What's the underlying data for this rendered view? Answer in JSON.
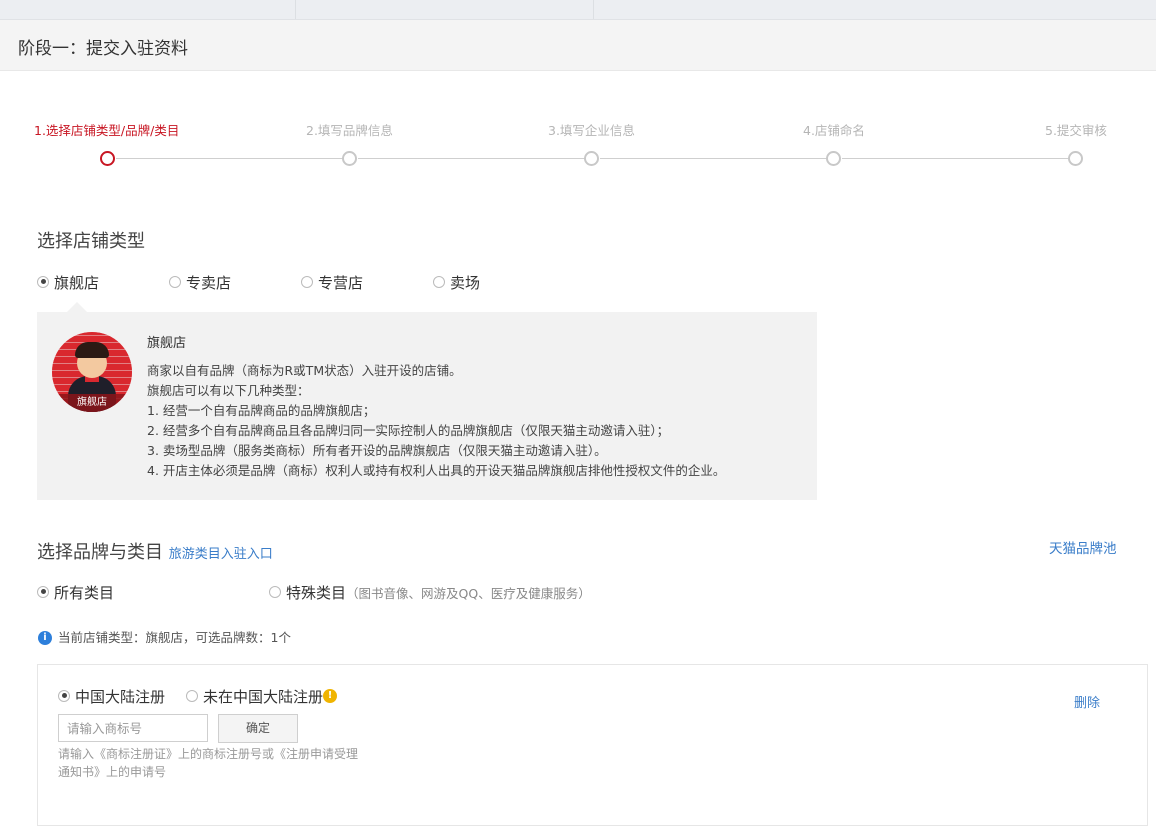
{
  "header": {
    "title": "阶段一：提交入驻资料"
  },
  "steps": [
    {
      "label": "1.选择店铺类型/品牌/类目",
      "active": true
    },
    {
      "label": "2.填写品牌信息",
      "active": false
    },
    {
      "label": "3.填写企业信息",
      "active": false
    },
    {
      "label": "4.店铺命名",
      "active": false
    },
    {
      "label": "5.提交审核",
      "active": false
    }
  ],
  "shop_type": {
    "title": "选择店铺类型",
    "options": [
      {
        "label": "旗舰店",
        "selected": true
      },
      {
        "label": "专卖店",
        "selected": false
      },
      {
        "label": "专营店",
        "selected": false
      },
      {
        "label": "卖场",
        "selected": false
      }
    ],
    "info": {
      "avatar_tag": "旗舰店",
      "heading": "旗舰店",
      "lines": [
        "商家以自有品牌（商标为R或TM状态）入驻开设的店铺。",
        "旗舰店可以有以下几种类型：",
        "1. 经营一个自有品牌商品的品牌旗舰店；",
        "2. 经营多个自有品牌商品且各品牌归同一实际控制人的品牌旗舰店（仅限天猫主动邀请入驻）；",
        "3. 卖场型品牌（服务类商标）所有者开设的品牌旗舰店（仅限天猫主动邀请入驻）。",
        "4. 开店主体必须是品牌（商标）权利人或持有权利人出具的开设天猫品牌旗舰店排他性授权文件的企业。"
      ]
    }
  },
  "brand_category": {
    "title": "选择品牌与类目",
    "travel_link": "旅游类目入驻入口",
    "brand_pool_link": "天猫品牌池",
    "options": [
      {
        "label": "所有类目",
        "selected": true
      },
      {
        "label": "特殊类目",
        "selected": false,
        "note": "（图书音像、网游及QQ、医疗及健康服务）"
      }
    ],
    "notice": "当前店铺类型：旗舰店，可选品牌数：1个"
  },
  "brand_entry": {
    "registration_options": [
      {
        "label": "中国大陆注册",
        "selected": true
      },
      {
        "label": "未在中国大陆注册",
        "selected": false
      }
    ],
    "delete_label": "删除",
    "input_placeholder": "请输入商标号",
    "confirm_label": "确定",
    "hint_line1": "请输入《商标注册证》上的商标注册号或《注册申请受理",
    "hint_line2": "通知书》上的申请号"
  },
  "colors": {
    "accent": "#c81623",
    "link": "#3a7dc9",
    "info_icon": "#2d7fdb",
    "warn_icon": "#f0b400"
  }
}
